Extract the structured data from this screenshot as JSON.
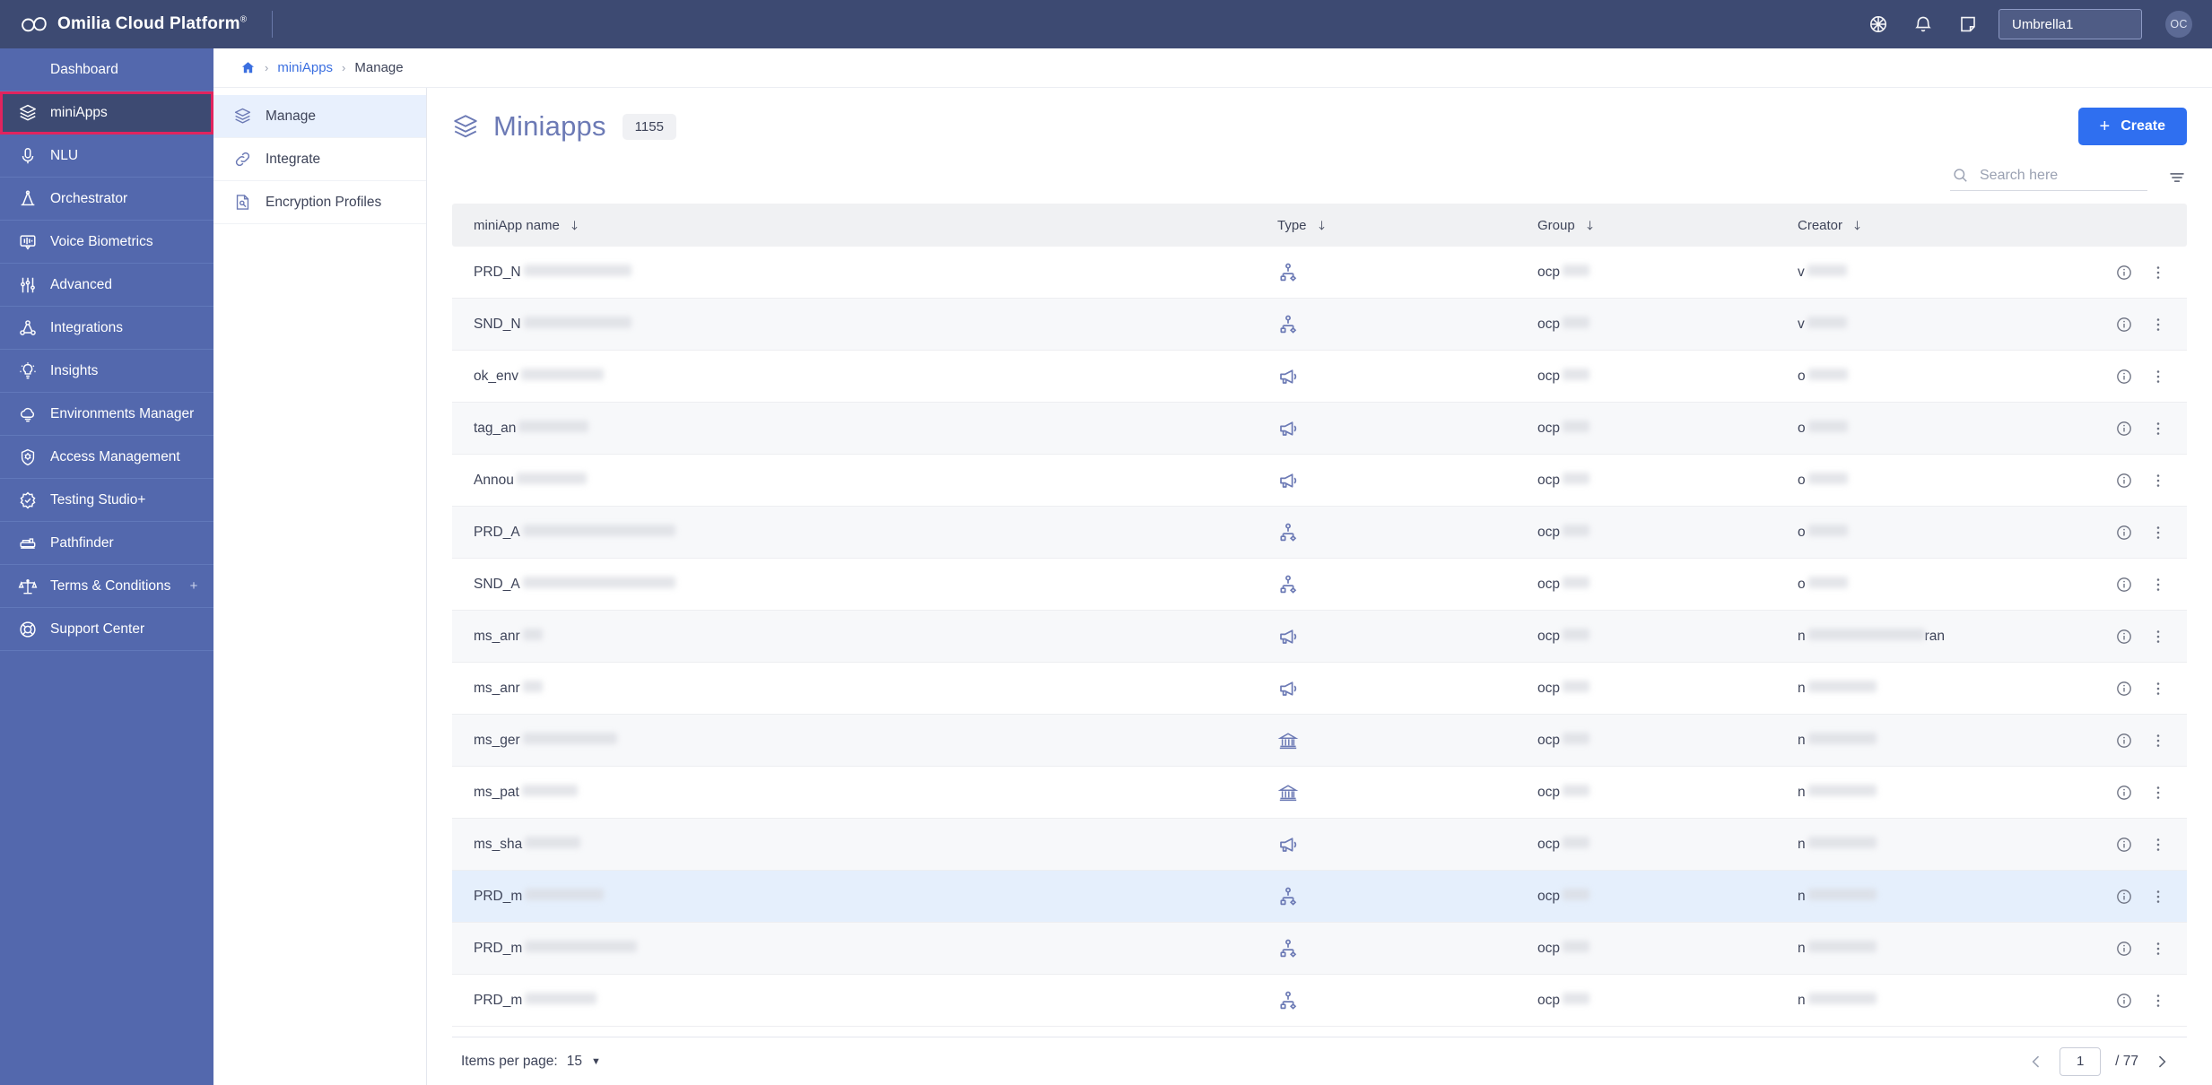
{
  "topbar": {
    "brand": "Omilia Cloud Platform",
    "brand_mark": "®",
    "icons": [
      {
        "name": "globe-icon"
      },
      {
        "name": "bell-icon"
      },
      {
        "name": "note-icon"
      }
    ],
    "umbrella_value": "Umbrella1",
    "avatar_initials": "OC"
  },
  "sidebar": {
    "items": [
      {
        "label": "Dashboard",
        "icon": "home-icon",
        "active": false,
        "outlined": false,
        "expandable": false
      },
      {
        "label": "miniApps",
        "icon": "layers-icon",
        "active": true,
        "outlined": true,
        "expandable": false
      },
      {
        "label": "NLU",
        "icon": "microphone-icon",
        "active": false,
        "outlined": false,
        "expandable": false
      },
      {
        "label": "Orchestrator",
        "icon": "orchestrator-icon",
        "active": false,
        "outlined": false,
        "expandable": false
      },
      {
        "label": "Voice Biometrics",
        "icon": "voice-biometrics-icon",
        "active": false,
        "outlined": false,
        "expandable": false
      },
      {
        "label": "Advanced",
        "icon": "sliders-icon",
        "active": false,
        "outlined": false,
        "expandable": false
      },
      {
        "label": "Integrations",
        "icon": "integrations-icon",
        "active": false,
        "outlined": false,
        "expandable": false
      },
      {
        "label": "Insights",
        "icon": "lightbulb-icon",
        "active": false,
        "outlined": false,
        "expandable": false
      },
      {
        "label": "Environments Manager",
        "icon": "cloud-icon",
        "active": false,
        "outlined": false,
        "expandable": false
      },
      {
        "label": "Access Management",
        "icon": "access-gear-icon",
        "active": false,
        "outlined": false,
        "expandable": false
      },
      {
        "label": "Testing Studio+",
        "icon": "check-badge-icon",
        "active": false,
        "outlined": false,
        "expandable": false
      },
      {
        "label": "Pathfinder",
        "icon": "pathfinder-icon",
        "active": false,
        "outlined": false,
        "expandable": false
      },
      {
        "label": "Terms & Conditions",
        "icon": "scales-icon",
        "active": false,
        "outlined": false,
        "expandable": true,
        "expander": "+"
      },
      {
        "label": "Support Center",
        "icon": "support-icon",
        "active": false,
        "outlined": false,
        "expandable": false
      }
    ]
  },
  "breadcrumb": {
    "home_icon": "home-icon",
    "sep": "›",
    "link": "miniApps",
    "current": "Manage"
  },
  "subnav": {
    "items": [
      {
        "label": "Manage",
        "icon": "layers-icon",
        "active": true
      },
      {
        "label": "Integrate",
        "icon": "link-icon",
        "active": false
      },
      {
        "label": "Encryption Profiles",
        "icon": "encryption-icon",
        "active": false
      }
    ]
  },
  "page": {
    "icon": "layers-icon",
    "title": "Miniapps",
    "count": "1155",
    "create_label": "Create",
    "create_plus": "+",
    "accent_color": "#2f6ff0",
    "title_color": "#6c7ab5"
  },
  "search": {
    "placeholder": "Search here",
    "value": "",
    "icon": "search-icon",
    "filter_icon": "filter-icon"
  },
  "table": {
    "columns": [
      {
        "key": "name",
        "label": "miniApp name",
        "sort_icon": "sort-down-icon"
      },
      {
        "key": "type",
        "label": "Type",
        "sort_icon": "sort-down-icon"
      },
      {
        "key": "group",
        "label": "Group",
        "sort_icon": "sort-down-icon"
      },
      {
        "key": "creator",
        "label": "Creator",
        "sort_icon": "sort-down-icon"
      }
    ],
    "rows": [
      {
        "name": "PRD_N",
        "name_redacted_w": 120,
        "type_icon": "flow-icon",
        "group": "ocp",
        "group_redacted_w": 30,
        "creator": "v",
        "creator_redacted_w": 44,
        "highlight": false
      },
      {
        "name": "SND_N",
        "name_redacted_w": 120,
        "type_icon": "flow-icon",
        "group": "ocp",
        "group_redacted_w": 30,
        "creator": "v",
        "creator_redacted_w": 44,
        "highlight": false
      },
      {
        "name": "ok_env",
        "name_redacted_w": 92,
        "type_icon": "megaphone-icon",
        "group": "ocp",
        "group_redacted_w": 30,
        "creator": "o",
        "creator_redacted_w": 44,
        "highlight": false
      },
      {
        "name": "tag_an",
        "name_redacted_w": 78,
        "type_icon": "megaphone-icon",
        "group": "ocp",
        "group_redacted_w": 30,
        "creator": "o",
        "creator_redacted_w": 44,
        "highlight": false
      },
      {
        "name": "Annou",
        "name_redacted_w": 78,
        "type_icon": "megaphone-icon",
        "group": "ocp",
        "group_redacted_w": 30,
        "creator": "o",
        "creator_redacted_w": 44,
        "highlight": false
      },
      {
        "name": "PRD_A",
        "name_redacted_w": 170,
        "type_icon": "flow-icon",
        "group": "ocp",
        "group_redacted_w": 30,
        "creator": "o",
        "creator_redacted_w": 44,
        "highlight": false
      },
      {
        "name": "SND_A",
        "name_redacted_w": 170,
        "type_icon": "flow-icon",
        "group": "ocp",
        "group_redacted_w": 30,
        "creator": "o",
        "creator_redacted_w": 44,
        "highlight": false
      },
      {
        "name": "ms_anr",
        "name_redacted_w": 22,
        "type_icon": "megaphone-icon",
        "group": "ocp",
        "group_redacted_w": 30,
        "creator": "n",
        "creator_redacted_w": 130,
        "creator_tail": "ran",
        "highlight": false
      },
      {
        "name": "ms_anr",
        "name_redacted_w": 22,
        "type_icon": "megaphone-icon",
        "group": "ocp",
        "group_redacted_w": 30,
        "creator": "n",
        "creator_redacted_w": 76,
        "highlight": false
      },
      {
        "name": "ms_ger",
        "name_redacted_w": 105,
        "type_icon": "bank-icon",
        "group": "ocp",
        "group_redacted_w": 30,
        "creator": "n",
        "creator_redacted_w": 76,
        "highlight": false
      },
      {
        "name": "ms_pat",
        "name_redacted_w": 62,
        "type_icon": "bank-icon",
        "group": "ocp",
        "group_redacted_w": 30,
        "creator": "n",
        "creator_redacted_w": 76,
        "highlight": false
      },
      {
        "name": "ms_sha",
        "name_redacted_w": 62,
        "type_icon": "megaphone-icon",
        "group": "ocp",
        "group_redacted_w": 30,
        "creator": "n",
        "creator_redacted_w": 76,
        "highlight": false
      },
      {
        "name": "PRD_m",
        "name_redacted_w": 88,
        "type_icon": "flow-icon",
        "group": "ocp",
        "group_redacted_w": 30,
        "creator": "n",
        "creator_redacted_w": 76,
        "highlight": true
      },
      {
        "name": "PRD_m",
        "name_redacted_w": 125,
        "type_icon": "flow-icon",
        "group": "ocp",
        "group_redacted_w": 30,
        "creator": "n",
        "creator_redacted_w": 76,
        "highlight": false
      },
      {
        "name": "PRD_m",
        "name_redacted_w": 80,
        "type_icon": "flow-icon",
        "group": "ocp",
        "group_redacted_w": 30,
        "creator": "n",
        "creator_redacted_w": 76,
        "highlight": false
      }
    ],
    "row_info_icon": "info-icon",
    "row_menu_icon": "kebab-menu-icon"
  },
  "footer": {
    "items_per_page_label": "Items per page:",
    "items_per_page_value": "15",
    "caret": "▼",
    "prev_icon": "chevron-left-icon",
    "next_icon": "chevron-right-icon",
    "current_page": "1",
    "page_separator": "/",
    "total_pages": "77"
  }
}
